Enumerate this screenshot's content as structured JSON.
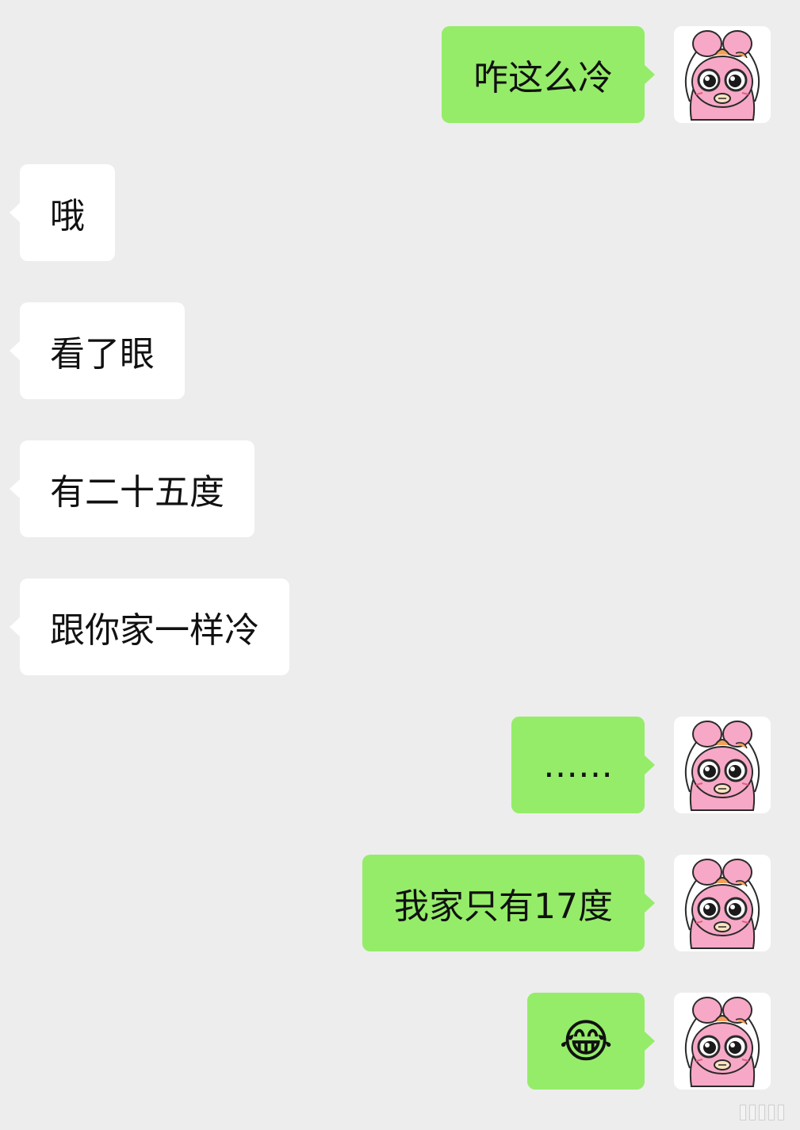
{
  "chat": {
    "messages": [
      {
        "side": "out",
        "text": "咋这么冷"
      },
      {
        "side": "in",
        "text": "哦"
      },
      {
        "side": "in",
        "text": "看了眼"
      },
      {
        "side": "in",
        "text": "有二十五度"
      },
      {
        "side": "in",
        "text": "跟你家一样冷"
      },
      {
        "side": "out",
        "text": "……"
      },
      {
        "side": "out",
        "text": "我家只有17度"
      },
      {
        "side": "out",
        "text": "😂"
      }
    ]
  },
  "avatar": {
    "icon": "pink-bunny-sticker-avatar"
  },
  "colors": {
    "background": "#ededed",
    "incoming_bubble": "#ffffff",
    "outgoing_bubble": "#95ec69",
    "text": "#111111"
  }
}
